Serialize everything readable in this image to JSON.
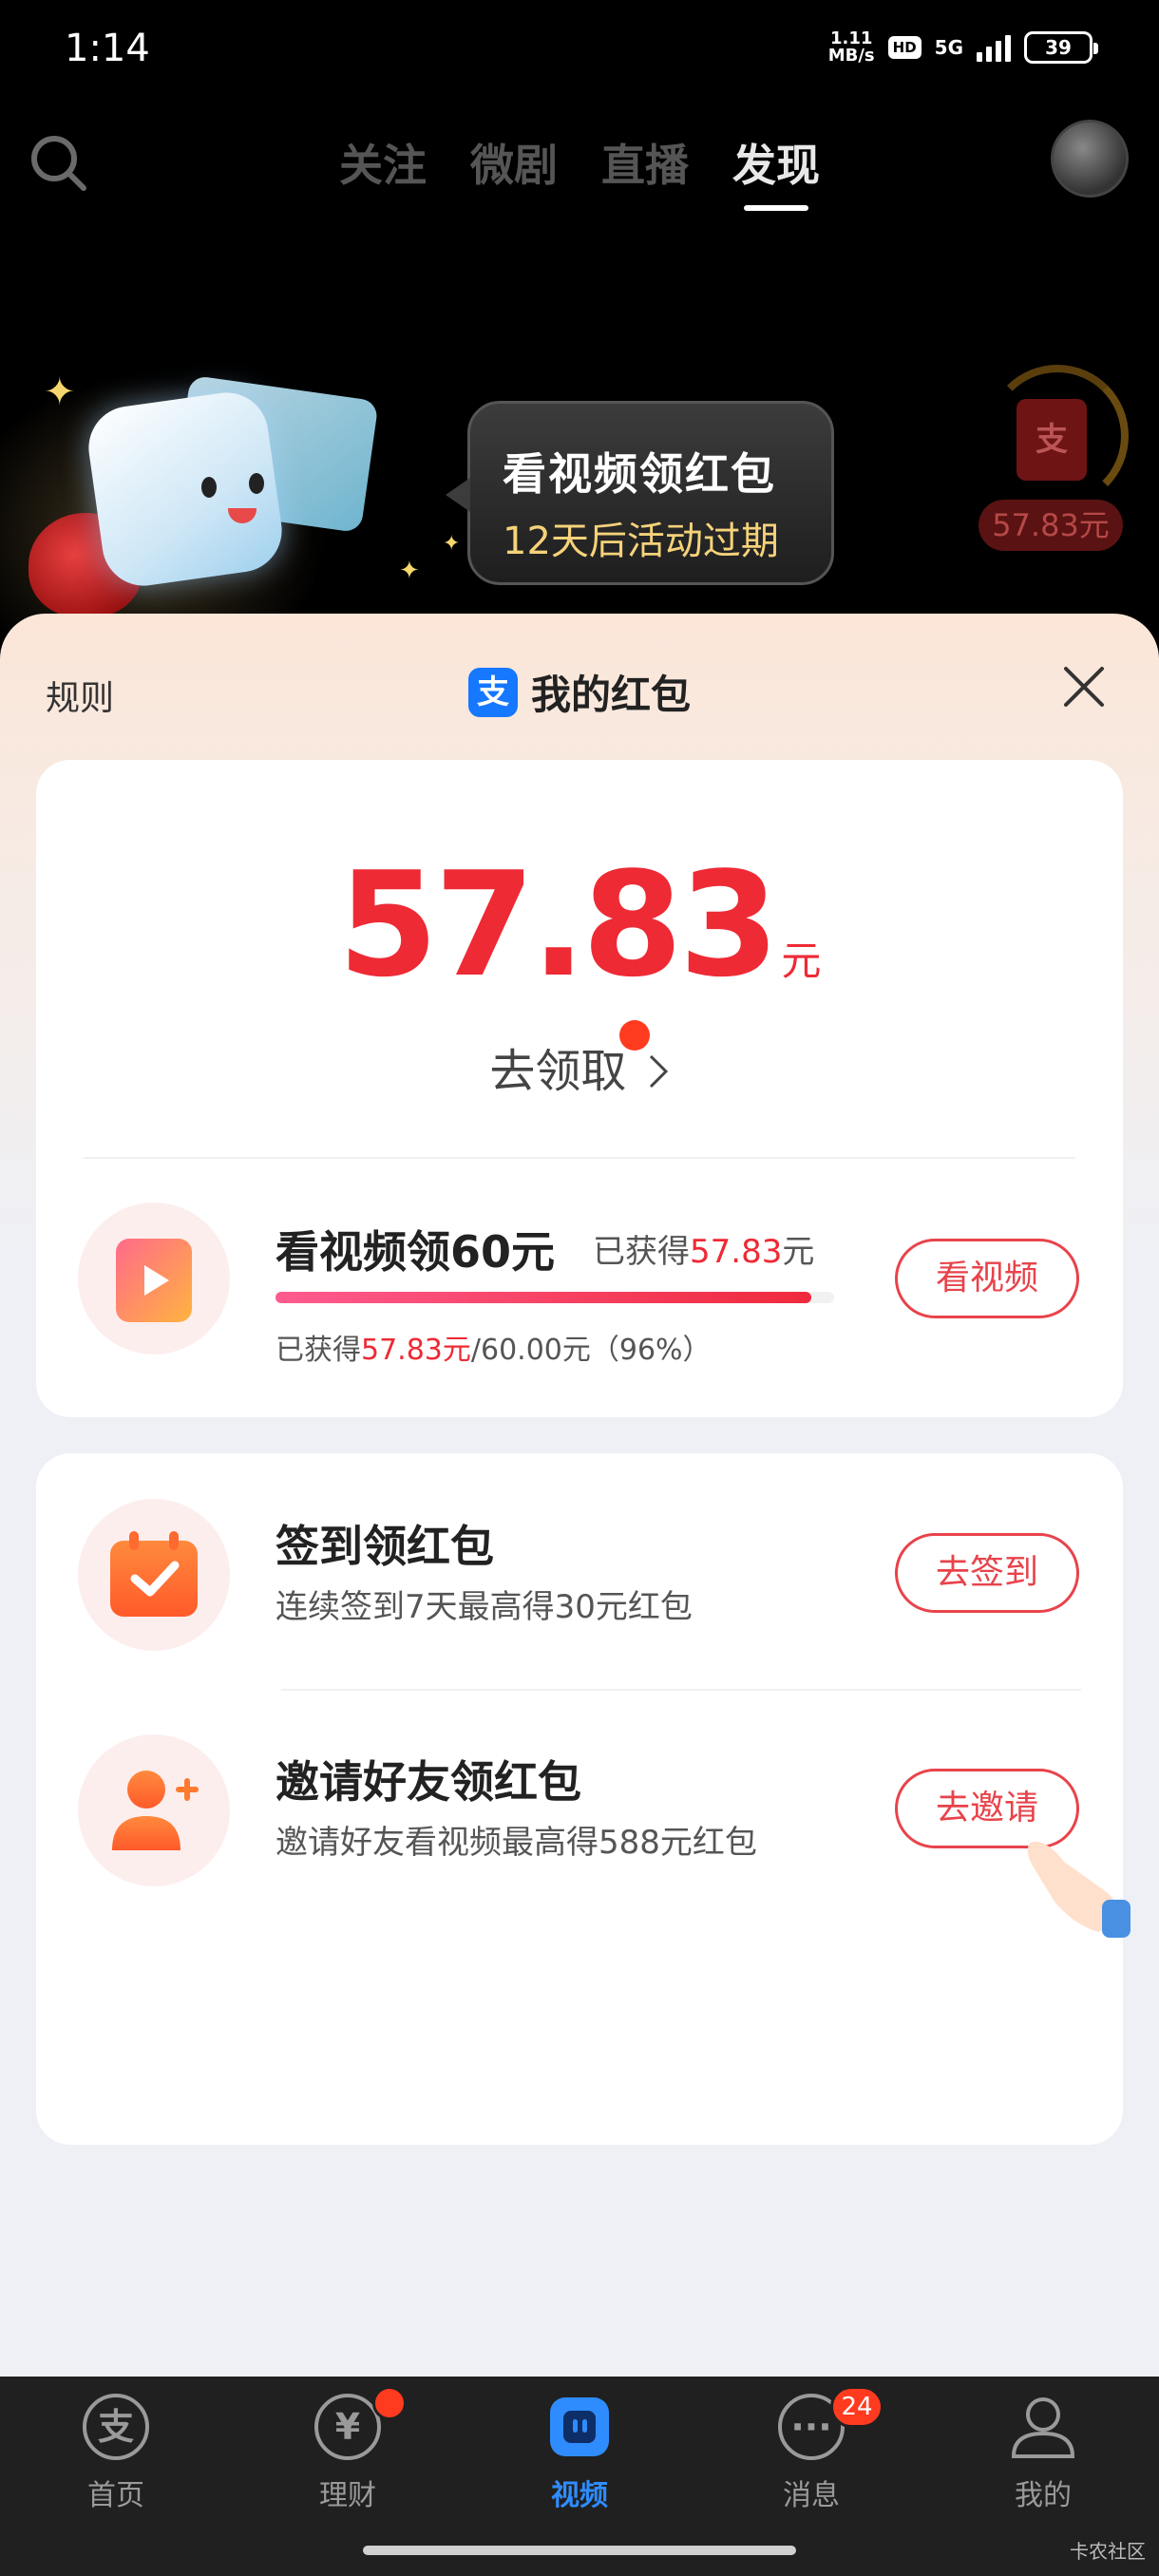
{
  "status_bar": {
    "time": "1:14",
    "speed_value": "1.11",
    "speed_unit": "MB/s",
    "hd": "HD",
    "network": "5G",
    "battery": "39"
  },
  "top_nav": {
    "tabs": [
      "关注",
      "微剧",
      "直播",
      "发现"
    ],
    "active_tab": "发现"
  },
  "promo": {
    "title": "看视频领红包",
    "subtitle": "12天后活动过期",
    "float_envelope_glyph": "支",
    "float_amount": "57.83元"
  },
  "sheet": {
    "rule": "规则",
    "brand_glyph": "支",
    "title": "我的红包",
    "amount": "57.83",
    "amount_unit": "元",
    "claim": "去领取"
  },
  "video_task": {
    "title": "看视频领60元",
    "earned_prefix": "已获得",
    "earned_value": "57.83",
    "earned_unit": "元",
    "progress_prefix": "已获得",
    "progress_value": "57.83元",
    "progress_rest": "/60.00元（96%）",
    "progress": 0.96,
    "button": "看视频"
  },
  "tasks": [
    {
      "title": "签到领红包",
      "desc": "连续签到7天最高得30元红包",
      "button": "去签到"
    },
    {
      "title": "邀请好友领红包",
      "desc": "邀请好友看视频最高得588元红包",
      "button": "去邀请"
    }
  ],
  "bottom_nav": {
    "items": [
      {
        "label": "首页",
        "glyph": "支"
      },
      {
        "label": "理财",
        "glyph": "¥"
      },
      {
        "label": "视频",
        "glyph": ""
      },
      {
        "label": "消息",
        "glyph": "···"
      },
      {
        "label": "我的",
        "glyph": ""
      }
    ],
    "active": "视频",
    "messages_badge": "24"
  },
  "watermark": "卡农社区",
  "colors": {
    "accent_red": "#ee2a35",
    "brand_blue": "#1677ff",
    "active_nav": "#2f8cff"
  }
}
